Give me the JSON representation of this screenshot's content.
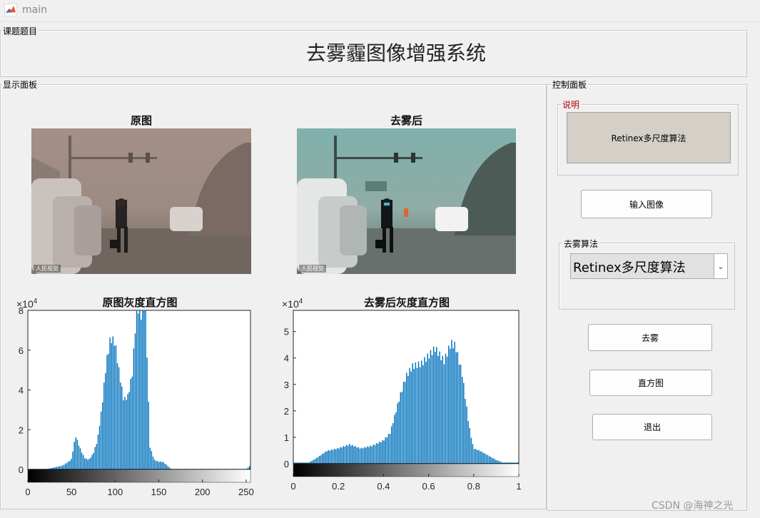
{
  "window": {
    "title": "main"
  },
  "panels": {
    "topic_label": "课题题目",
    "display_label": "显示面板",
    "control_label": "控制面板"
  },
  "main_title": "去雾霾图像增强系统",
  "images": {
    "original_title": "原图",
    "dehazed_title": "去雾后",
    "photo_tag": "人民视觉"
  },
  "histograms": {
    "original_title": "原图灰度直方图",
    "dehazed_title": "去雾后灰度直方图"
  },
  "controls": {
    "note_label": "说明",
    "note_text": "Retinex多尺度算法",
    "input_button": "输入图像",
    "algorithm_label": "去雾算法",
    "algorithm_selected": "Retinex多尺度算法",
    "dehaze_button": "去雾",
    "histogram_button": "直方图",
    "exit_button": "退出"
  },
  "watermark": "CSDN @海神之光",
  "colors": {
    "bar": "#0072bd",
    "note_label": "#b00000"
  },
  "chart_data": [
    {
      "type": "bar",
      "title": "原图灰度直方图",
      "xlabel": "",
      "ylabel": "",
      "y_multiplier": "×10^4",
      "xlim": [
        0,
        255
      ],
      "ylim": [
        0,
        8
      ],
      "xticks": [
        0,
        50,
        100,
        150,
        200,
        250
      ],
      "yticks": [
        0,
        2,
        4,
        6,
        8
      ],
      "colorbar": "grayscale 0-255",
      "x": [
        20,
        30,
        40,
        50,
        55,
        60,
        65,
        70,
        75,
        80,
        85,
        90,
        95,
        100,
        105,
        110,
        115,
        120,
        125,
        130,
        135,
        140,
        145,
        150,
        155,
        160,
        165,
        170,
        175,
        180,
        185,
        190,
        200,
        210,
        220,
        230,
        240,
        250,
        255
      ],
      "values": [
        0,
        0.1,
        0.2,
        0.5,
        1.75,
        1.1,
        0.6,
        0.5,
        0.8,
        1.5,
        3.2,
        5.5,
        6.8,
        6.6,
        5.0,
        3.6,
        3.8,
        5.0,
        8.5,
        8.0,
        8.8,
        1.2,
        0.5,
        0.4,
        0.4,
        0.2,
        0,
        0,
        0,
        0,
        0,
        0,
        0,
        0,
        0,
        0,
        0,
        0,
        0.2
      ]
    },
    {
      "type": "bar",
      "title": "去雾后灰度直方图",
      "xlabel": "",
      "ylabel": "",
      "y_multiplier": "×10^4",
      "xlim": [
        0,
        1
      ],
      "ylim": [
        0,
        5.8
      ],
      "xticks": [
        0,
        0.2,
        0.4,
        0.6,
        0.8,
        1
      ],
      "yticks": [
        0,
        1,
        2,
        3,
        4,
        5
      ],
      "colorbar": "grayscale 0-1",
      "x": [
        0.07,
        0.1,
        0.15,
        0.2,
        0.25,
        0.3,
        0.35,
        0.4,
        0.43,
        0.47,
        0.5,
        0.53,
        0.57,
        0.6,
        0.63,
        0.67,
        0.7,
        0.72,
        0.75,
        0.78,
        0.8,
        0.83,
        0.87,
        0.9,
        0.93,
        0.97
      ],
      "values": [
        0.05,
        0.2,
        0.5,
        0.6,
        0.75,
        0.6,
        0.7,
        0.9,
        1.2,
        2.5,
        3.4,
        3.8,
        3.9,
        4.2,
        4.5,
        4.0,
        4.7,
        4.6,
        3.5,
        1.5,
        0.6,
        0.5,
        0.3,
        0.15,
        0.05,
        0.05
      ]
    }
  ]
}
